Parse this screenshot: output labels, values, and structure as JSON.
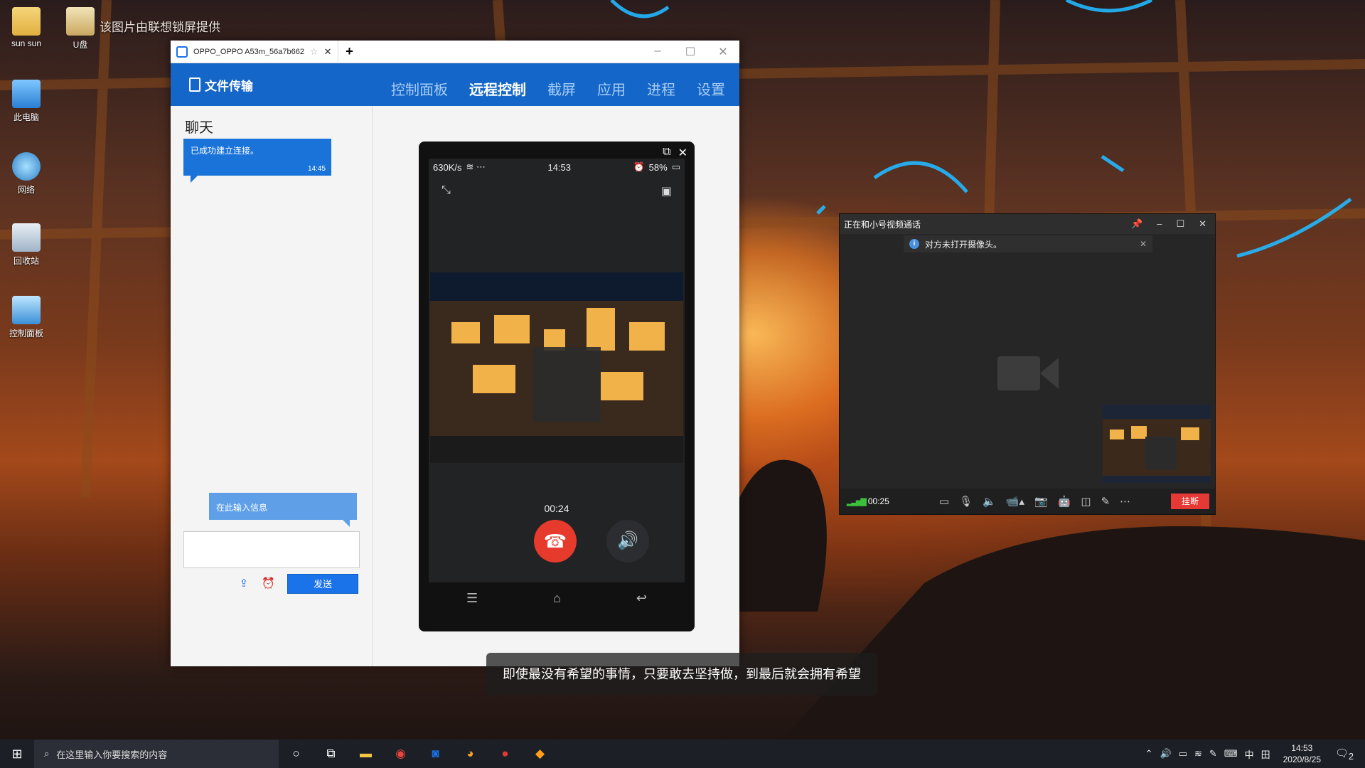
{
  "desktop": {
    "watermark": "该图片由联想锁屏提供",
    "icons": [
      {
        "label": "sun sun",
        "icon": "user-folder-icon"
      },
      {
        "label": "U盘",
        "icon": "usb-drive-icon"
      },
      {
        "label": "此电脑",
        "icon": "computer-icon"
      },
      {
        "label": "网络",
        "icon": "network-icon"
      },
      {
        "label": "回收站",
        "icon": "recycle-bin-icon"
      },
      {
        "label": "控制面板",
        "icon": "control-panel-icon"
      }
    ]
  },
  "main_window": {
    "tab_title": "OPPO_OPPO A53m_56a7b662",
    "brand": "文件传输",
    "nav": [
      "控制面板",
      "远程控制",
      "截屏",
      "应用",
      "进程",
      "设置"
    ],
    "active_nav": "远程控制",
    "chat": {
      "title": "聊天",
      "message": "已成功建立连接。",
      "message_time": "14:45",
      "input_hint": "在此输入信息",
      "send_label": "发送"
    },
    "phone": {
      "speed": "630K/s",
      "time": "14:53",
      "battery": "58%",
      "call_timer": "00:24"
    }
  },
  "video_call": {
    "title": "正在和小号视频通话",
    "notice": "对方未打开摄像头。",
    "timer": "00:25",
    "hangup_label": "挂断"
  },
  "subtitle": "即使最没有希望的事情，只要敢去坚持做，到最后就会拥有希望",
  "taskbar": {
    "search_placeholder": "在这里输入你要搜索的内容",
    "ime": "中",
    "time": "14:53",
    "date": "2020/8/25",
    "notification_count": "2"
  }
}
